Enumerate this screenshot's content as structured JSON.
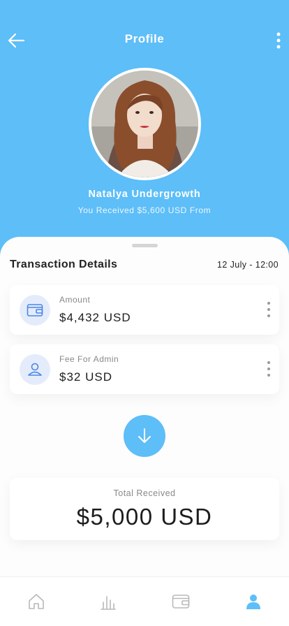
{
  "header": {
    "title": "Profile",
    "background_color": "#5dbef8",
    "back_icon": "arrow-left-icon",
    "menu_icon": "kebab-vertical-icon"
  },
  "profile": {
    "name": "Natalya Undergrowth",
    "subtitle": "You Received $5,600 USD From"
  },
  "transaction": {
    "section_title": "Transaction Details",
    "date": "12 July - 12:00",
    "items": [
      {
        "icon": "wallet-icon",
        "label": "Amount",
        "value": "$4,432 USD"
      },
      {
        "icon": "user-icon",
        "label": "Fee For Admin",
        "value": "$32 USD"
      }
    ],
    "action_icon": "arrow-down-icon"
  },
  "total": {
    "label": "Total Received",
    "value": "$5,000 USD"
  },
  "bottom_nav": {
    "items": [
      {
        "icon": "home-icon",
        "active": false
      },
      {
        "icon": "bar-chart-icon",
        "active": false
      },
      {
        "icon": "wallet-icon",
        "active": false
      },
      {
        "icon": "person-icon",
        "active": true
      }
    ],
    "active_color": "#5dbef8",
    "inactive_color": "#b9b9b9"
  }
}
